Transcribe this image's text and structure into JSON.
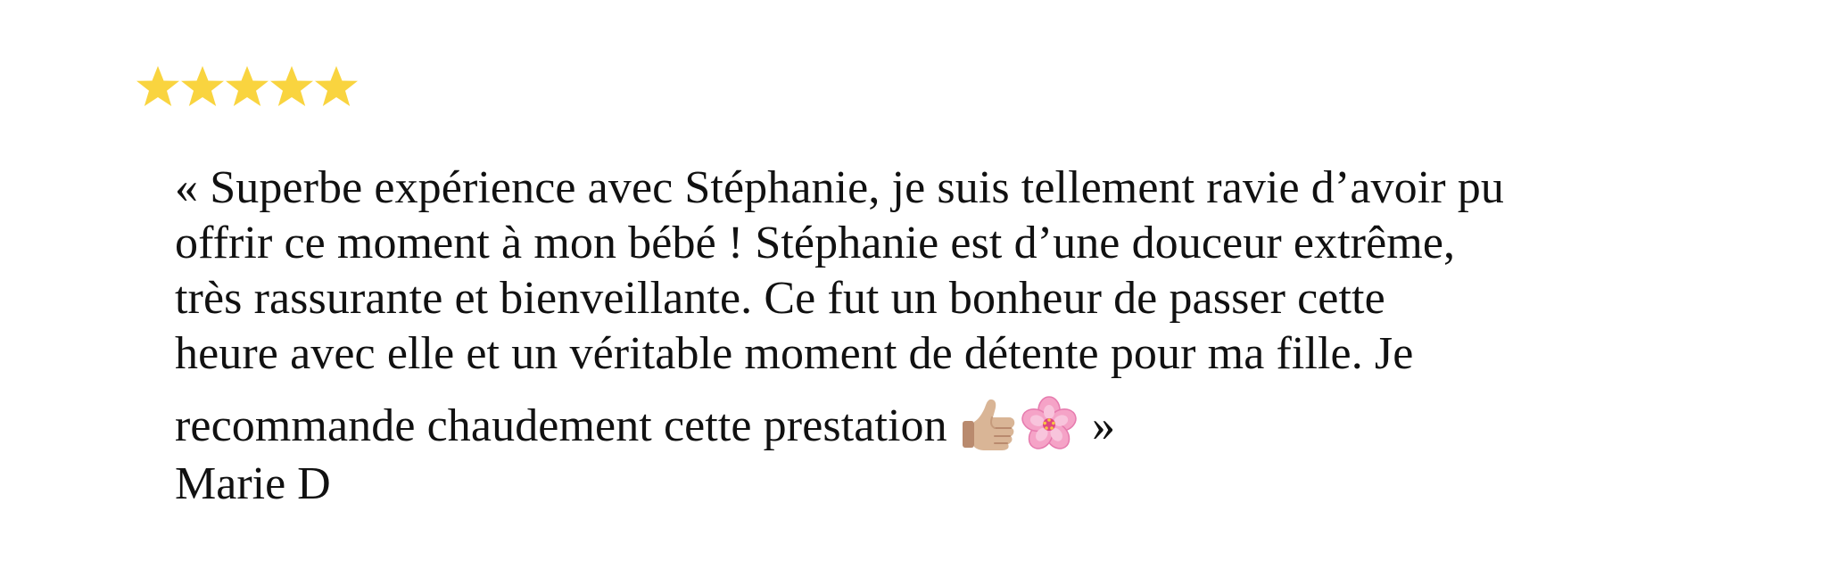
{
  "review": {
    "rating_stars": 5,
    "rating_max": 5,
    "star_color": "#F9D43F",
    "lines": [
      "« Superbe expérience avec Stéphanie, je suis tellement ravie d’avoir pu",
      "offrir ce moment à mon bébé ! Stéphanie est d’une douceur extrême,",
      "très rassurante et bienveillante. Ce fut un bonheur de passer cette",
      "heure avec elle et un véritable moment de détente pour ma fille. Je"
    ],
    "last_line_text": "recommande chaudement cette prestation ",
    "last_line_emojis": [
      "thumbs-up-icon",
      "cherry-blossom-icon"
    ],
    "closing_mark": " »",
    "author": "Marie D"
  }
}
